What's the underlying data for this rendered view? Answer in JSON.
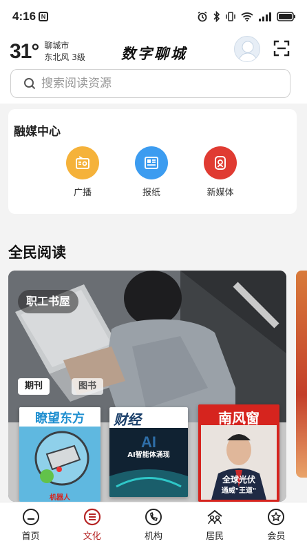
{
  "status_bar": {
    "time": "4:16",
    "n_badge": "N"
  },
  "header": {
    "temperature": "31°",
    "city": "聊城市",
    "wind": "东北风  3级",
    "app_title": "数字聊城"
  },
  "search": {
    "placeholder": "搜索阅读资源"
  },
  "media_center": {
    "title": "融媒中心",
    "items": [
      {
        "label": "广播",
        "icon": "radio-icon",
        "color": "#f5b23a"
      },
      {
        "label": "报纸",
        "icon": "newspaper-icon",
        "color": "#3c9cf0"
      },
      {
        "label": "新媒体",
        "icon": "new-media-icon",
        "color": "#e03b32"
      }
    ]
  },
  "reading": {
    "title": "全民阅读",
    "banner_tag": "职工书屋",
    "chips": [
      "期刊",
      "图书"
    ],
    "magazines": [
      {
        "title": "瞭望东方",
        "caption": "机器人",
        "color": "#29a6dc"
      },
      {
        "title": "财经",
        "caption": "AI智能体涌现",
        "color": "#0f1f2c"
      },
      {
        "title": "南风窗",
        "caption": "全球光伏",
        "subcaption": "通威\"王道\"",
        "color": "#d6241e"
      }
    ]
  },
  "bottom_nav": [
    {
      "label": "首页",
      "icon": "home-icon"
    },
    {
      "label": "文化",
      "icon": "culture-icon",
      "active": true
    },
    {
      "label": "机构",
      "icon": "institution-icon"
    },
    {
      "label": "居民",
      "icon": "resident-icon"
    },
    {
      "label": "会员",
      "icon": "member-icon"
    }
  ],
  "colors": {
    "accent": "#b52424",
    "background": "#f3f3f3"
  }
}
